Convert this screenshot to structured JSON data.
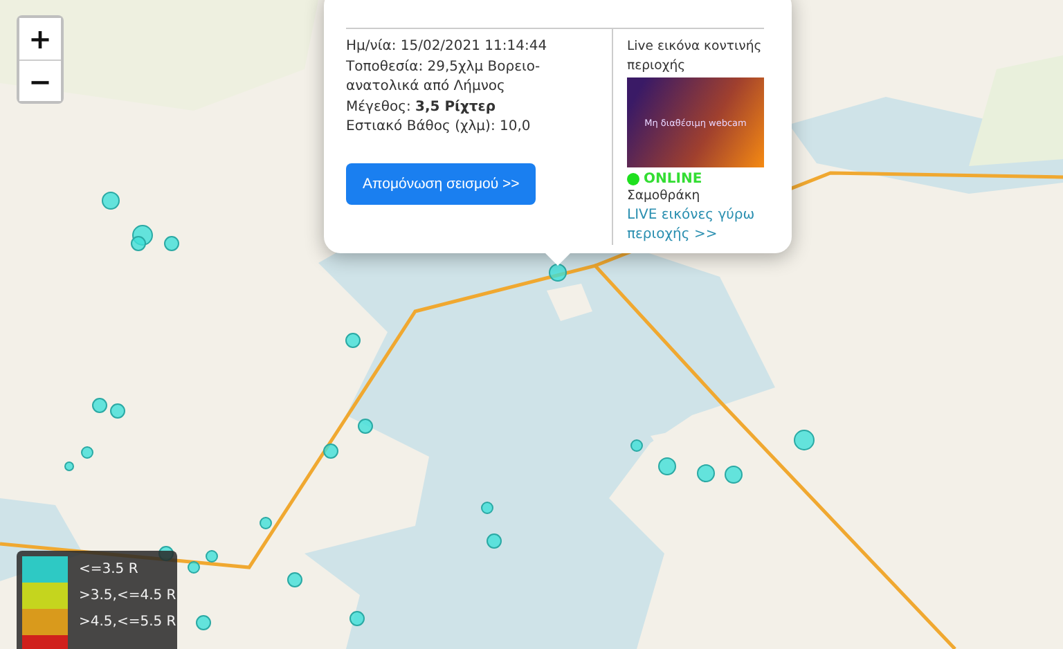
{
  "zoom_controls": [
    {
      "label": "+"
    },
    {
      "label": "−"
    }
  ],
  "popup": {
    "date": "Ημ/νία: 15/02/2021 11:14:44",
    "location": "Τοποθεσία: 29,5χλμ Βορειο-ανατολικά από Λήμνος",
    "magnitude": "Μέγεθος: **3,5 Ρίχτερ**",
    "depth": "Εστιακό Βάθος (χλμ): 10,0",
    "button": "Απομόνωση σεισμού >>",
    "webcam_title": "Live εικόνα κοντινής περιοχής",
    "webcam_placeholder": "Μη διαθέσιμη webcam",
    "status": {
      "label": "ONLINE",
      "online": true
    },
    "place": "Σαμοθράκη",
    "link": "LIVE εικόνες γύρω περιοχής >>"
  },
  "legend": [
    {
      "label": "<=3.5 R",
      "color": "#2ec9c4"
    },
    {
      "label": ">3.5,<=4.5 R",
      "color": "#c5d51e"
    },
    {
      "label": ">4.5,<=5.5 R",
      "color": "#d99a1c"
    },
    {
      "color": "#d0201c"
    }
  ]
}
